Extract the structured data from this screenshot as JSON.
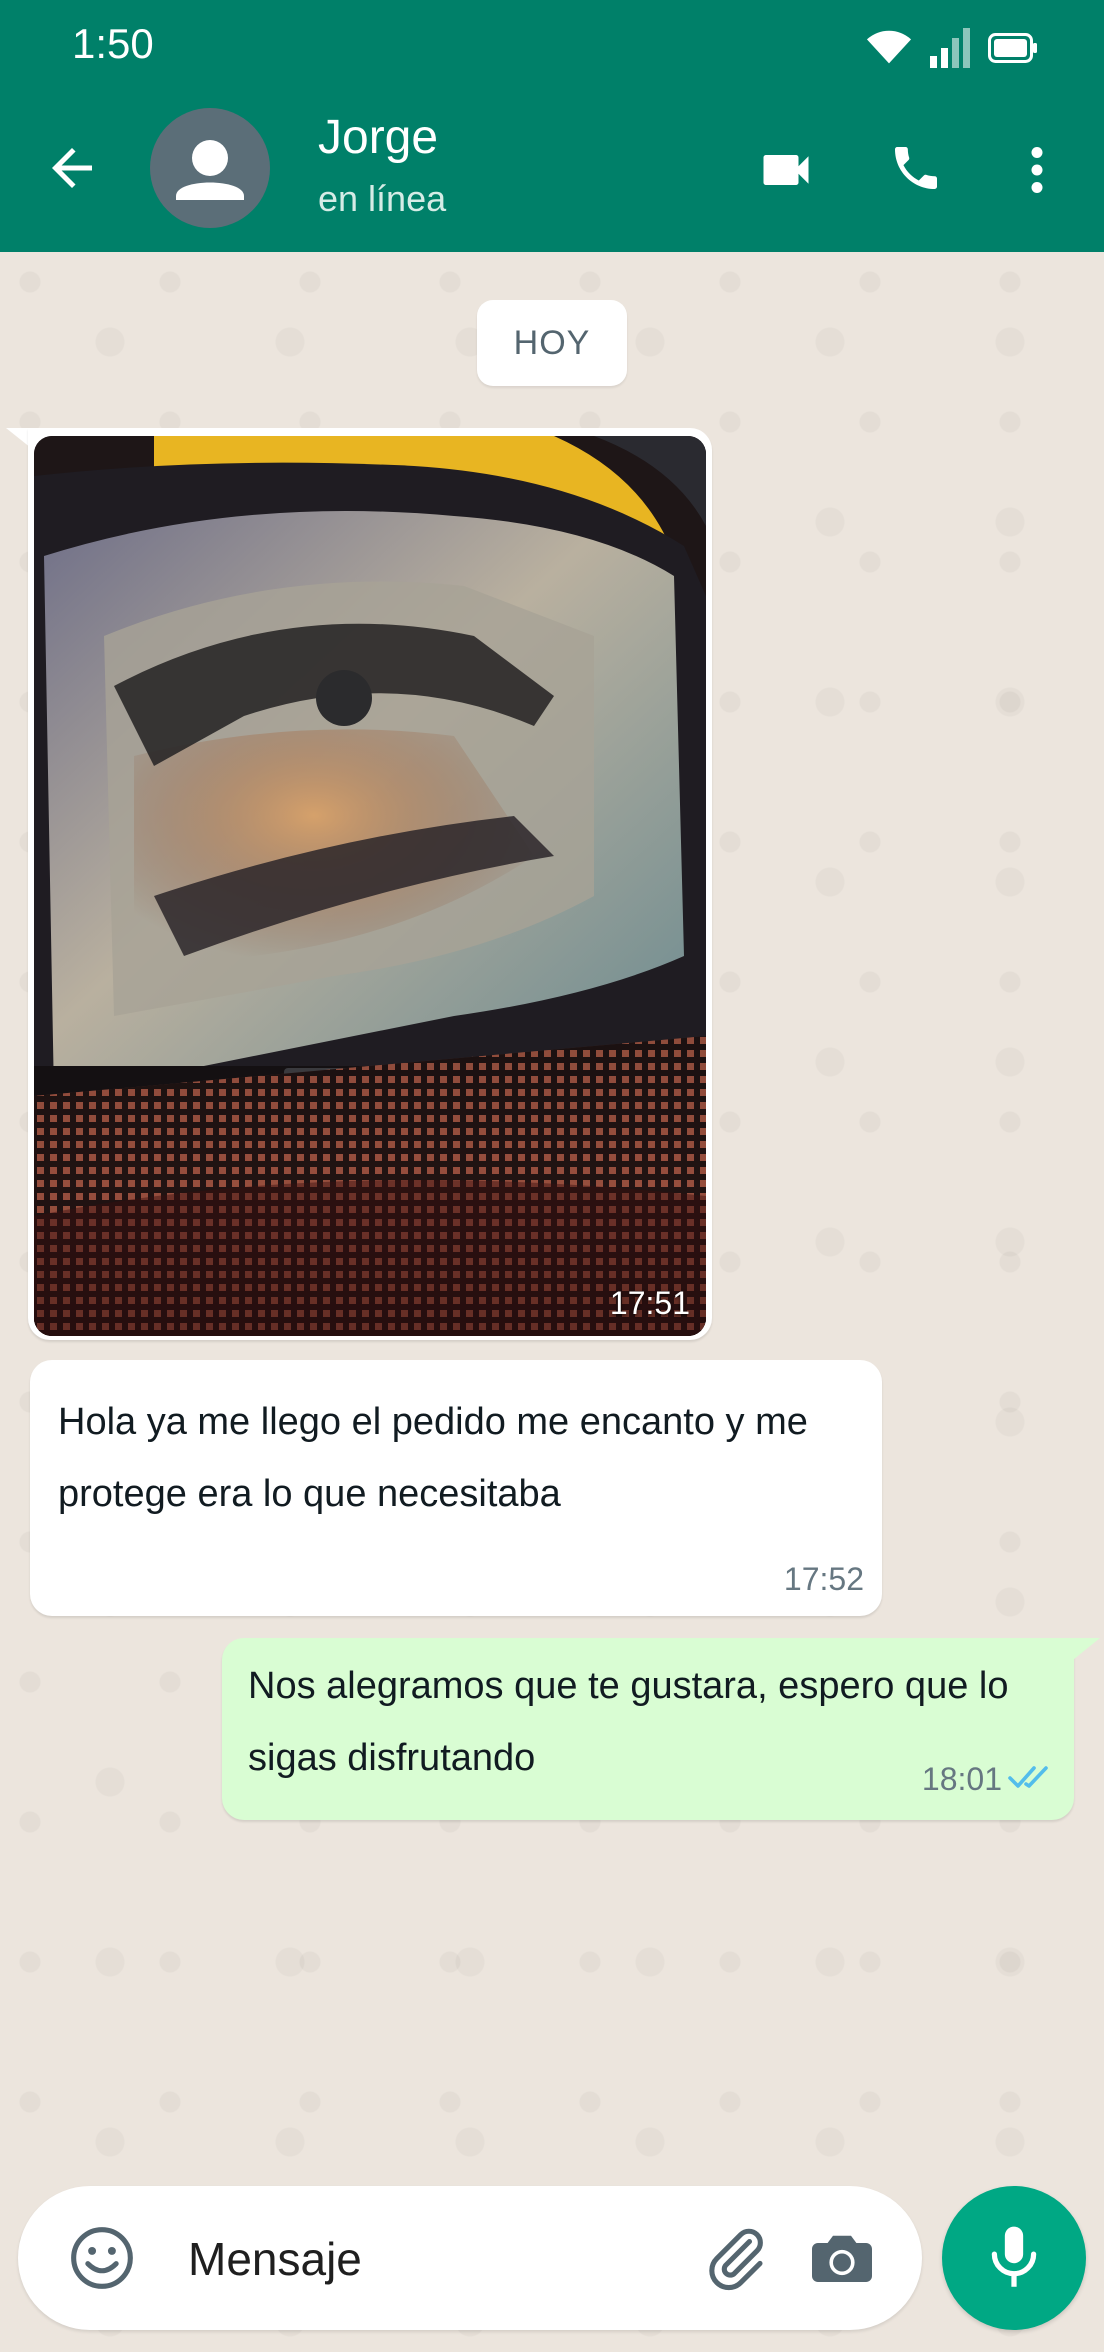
{
  "status_bar": {
    "time": "1:50"
  },
  "header": {
    "contact_name": "Jorge",
    "contact_status": "en línea",
    "icons": [
      "back-arrow-icon",
      "video-call-icon",
      "voice-call-icon",
      "more-options-icon"
    ]
  },
  "chat": {
    "day_label": "HOY",
    "messages": [
      {
        "type": "image",
        "direction": "incoming",
        "time": "17:51"
      },
      {
        "type": "text",
        "direction": "incoming",
        "text": "Hola ya me llego el pedido me encanto y me protege era lo que necesitaba",
        "time": "17:52"
      },
      {
        "type": "text",
        "direction": "outgoing",
        "text": "Nos alegramos que te gustara, espero que lo sigas disfrutando",
        "time": "18:01",
        "status": "read"
      }
    ]
  },
  "composer": {
    "placeholder": "Mensaje",
    "icons": [
      "emoji-icon",
      "attach-icon",
      "camera-icon",
      "mic-icon"
    ]
  },
  "colors": {
    "header": "#008069",
    "chat_background": "#ece5dd",
    "outgoing_bubble": "#d9fdd3",
    "mic_button": "#00a884",
    "read_ticks": "#53bdeb"
  }
}
